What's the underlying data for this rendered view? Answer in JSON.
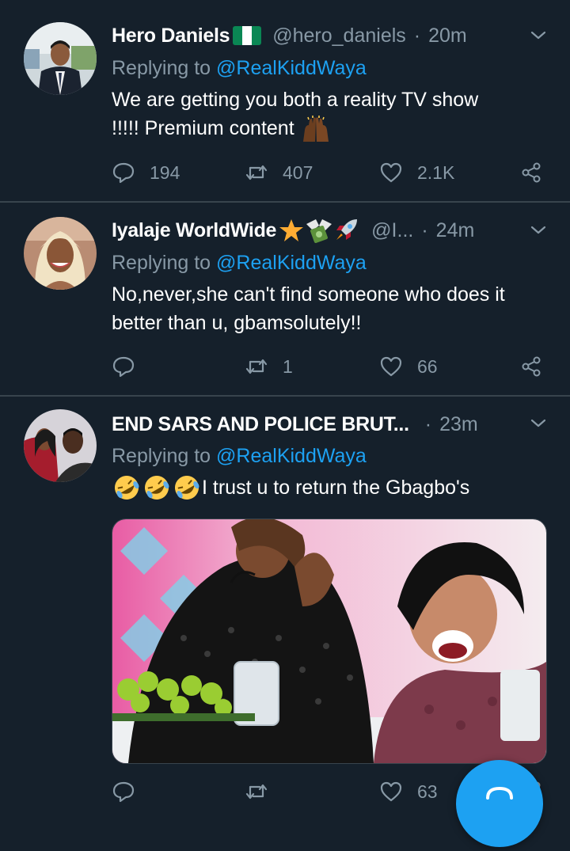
{
  "tweets": [
    {
      "name": "Hero Daniels",
      "handle": "@hero_daniels",
      "separator": "·",
      "time": "20m",
      "replying_prefix": "Replying to ",
      "replying_to": "@RealKiddWaya",
      "text_line1": "We are getting you both a reality TV show",
      "text_line2": "!!!!! Premium content",
      "actions": {
        "replies": "194",
        "retweets": "407",
        "likes": "2.1K"
      }
    },
    {
      "name": "Iyalaje WorldWide",
      "handle": "@I...",
      "separator": "·",
      "time": "24m",
      "replying_prefix": "Replying to ",
      "replying_to": "@RealKiddWaya",
      "text_line1": "No,never,she can't find someone who does it",
      "text_line2": "better than u, gbamsolutely!!",
      "actions": {
        "replies": "",
        "retweets": "1",
        "likes": "66"
      }
    },
    {
      "name": "END SARS AND POLICE BRUT...",
      "handle": "",
      "separator": "·",
      "time": "23m",
      "replying_prefix": "Replying to ",
      "replying_to": "@RealKiddWaya",
      "text_line1": "I trust u to return the Gbagbo's",
      "actions": {
        "replies": "",
        "retweets": "",
        "likes": "63"
      }
    }
  ],
  "icons": {
    "reply": "reply-icon",
    "retweet": "retweet-icon",
    "like": "heart-icon",
    "share": "share-icon",
    "menu": "chevron-down-icon",
    "compose": "compose-icon"
  },
  "colors": {
    "background": "#15202b",
    "divider": "#38444d",
    "secondary_text": "#8899a6",
    "link": "#1da1f2",
    "fab": "#1da1f2"
  }
}
